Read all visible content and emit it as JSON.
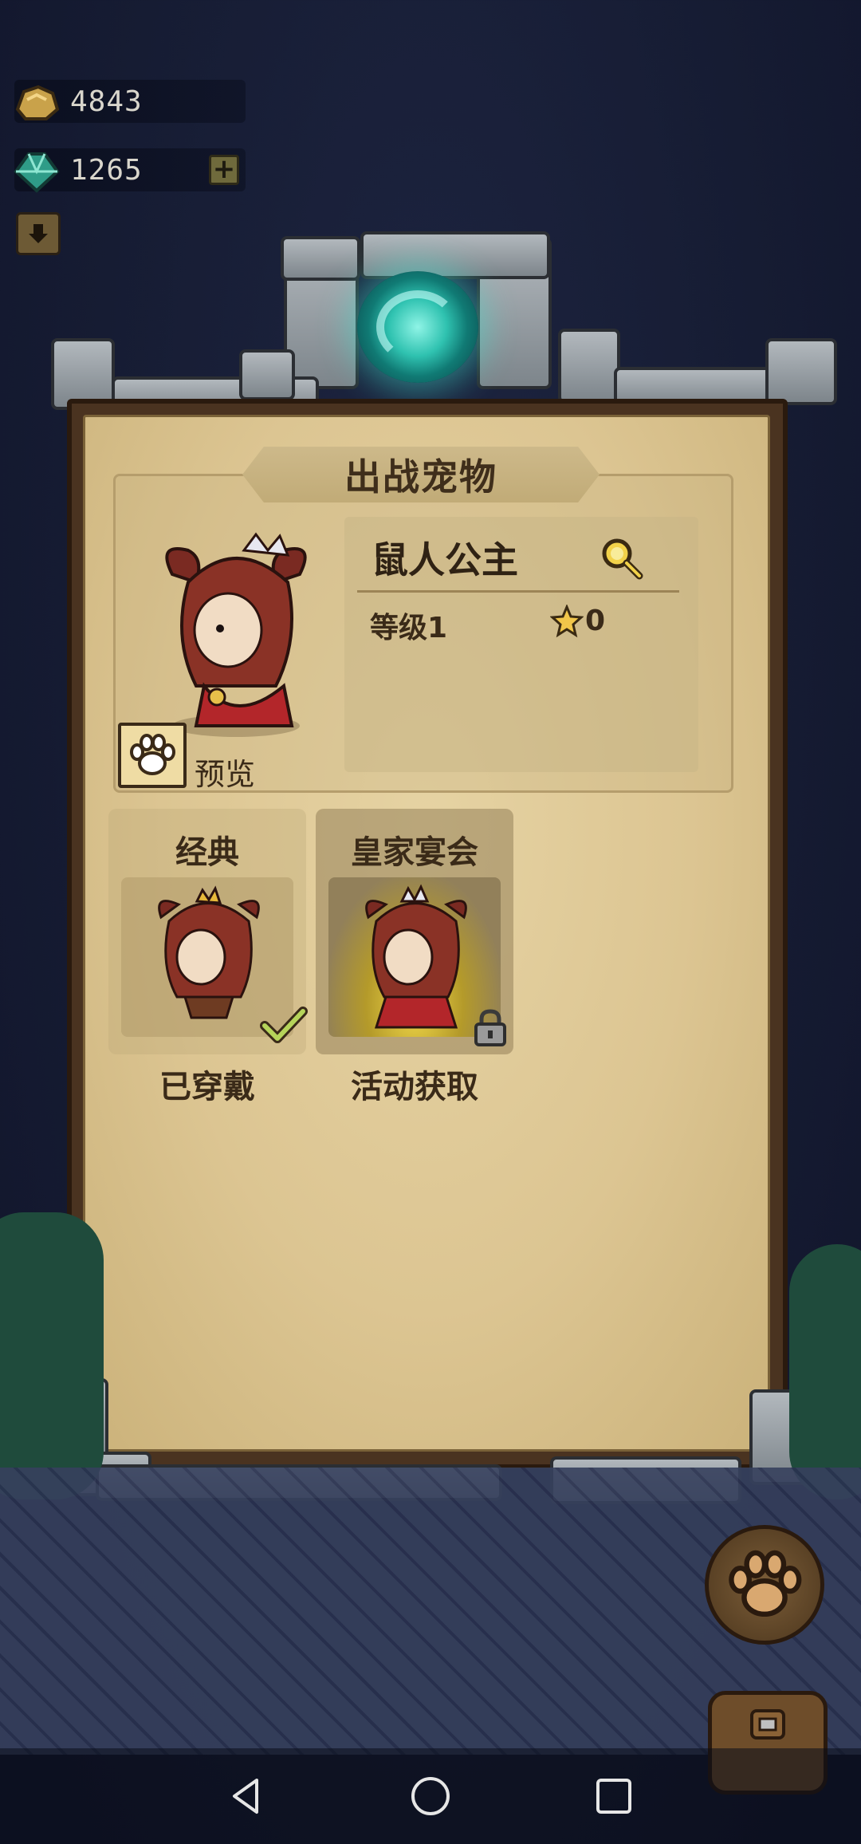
{
  "resources": {
    "gold": "4843",
    "gems": "1265",
    "gems_add_label": "+"
  },
  "panel": {
    "title": "出战宠物",
    "pet_name": "鼠人公主",
    "level": "等级1",
    "stars": "0",
    "preview_label": "预览"
  },
  "skins": [
    {
      "title": "经典",
      "status": "已穿戴",
      "equipped": true,
      "locked": false
    },
    {
      "title": "皇家宴会",
      "status": "活动获取",
      "equipped": false,
      "locked": true
    }
  ],
  "icons": {
    "gold": "gold-nugget-icon",
    "gem": "gem-icon",
    "download": "arrow-down-icon",
    "search": "magnifier-icon",
    "star": "star-icon",
    "paw": "paw-icon",
    "check": "checkmark-icon",
    "lock": "lock-icon",
    "bag": "backpack-icon"
  },
  "colors": {
    "parchment": "#dcc592",
    "portal": "#2fc2b0",
    "text_dark": "#3a2a18",
    "night_bg": "#161c33"
  }
}
